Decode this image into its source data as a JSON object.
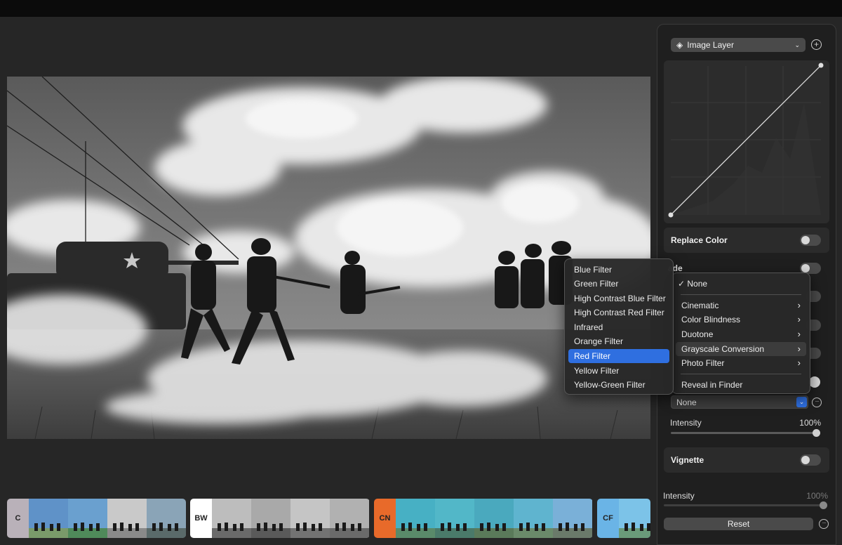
{
  "layer": {
    "label": "Image Layer",
    "add_symbol": "+"
  },
  "panel": {
    "replace_color": "Replace Color",
    "fade_partial": "ade",
    "lut_value": "None",
    "intensity": {
      "label": "Intensity",
      "value": "100%"
    },
    "vignette": "Vignette",
    "intensity2": {
      "label": "Intensity",
      "value": "100%"
    },
    "reset": "Reset",
    "more_symbol": "···"
  },
  "lut_menu": {
    "items": [
      {
        "label": "None",
        "checked": true
      },
      {
        "label": "Cinematic",
        "submenu": true
      },
      {
        "label": "Color Blindness",
        "submenu": true
      },
      {
        "label": "Duotone",
        "submenu": true
      },
      {
        "label": "Grayscale Conversion",
        "submenu": true,
        "active": true
      },
      {
        "label": "Photo Filter",
        "submenu": true
      },
      {
        "label": "Reveal in Finder"
      }
    ]
  },
  "grayscale_submenu": {
    "items": [
      "Blue Filter",
      "Green Filter",
      "High Contrast Blue Filter",
      "High Contrast Red Filter",
      "Infrared",
      "Orange Filter",
      "Red Filter",
      "Yellow Filter",
      "Yellow-Green Filter"
    ],
    "selected": "Red Filter"
  },
  "filmstrip": [
    {
      "tag": "C",
      "color": "#b9b1b9",
      "thumbs": [
        "#5f92c8",
        "#6aa0cf",
        "#c9c9c9",
        "#8aa4b7"
      ]
    },
    {
      "tag": "BW",
      "color": "#ffffff",
      "thumbs": [
        "#bdbdbd",
        "#a9a9a9",
        "#c5c5c5",
        "#b1b1b1"
      ]
    },
    {
      "tag": "CN",
      "color": "#e86a2a",
      "thumbs": [
        "#47b0c4",
        "#52b7c8",
        "#4aa9be",
        "#5fb4cf"
      ]
    },
    {
      "tag": "CF",
      "color": "#6ab4e6",
      "thumbs": [
        "#7cc3e8"
      ]
    }
  ]
}
